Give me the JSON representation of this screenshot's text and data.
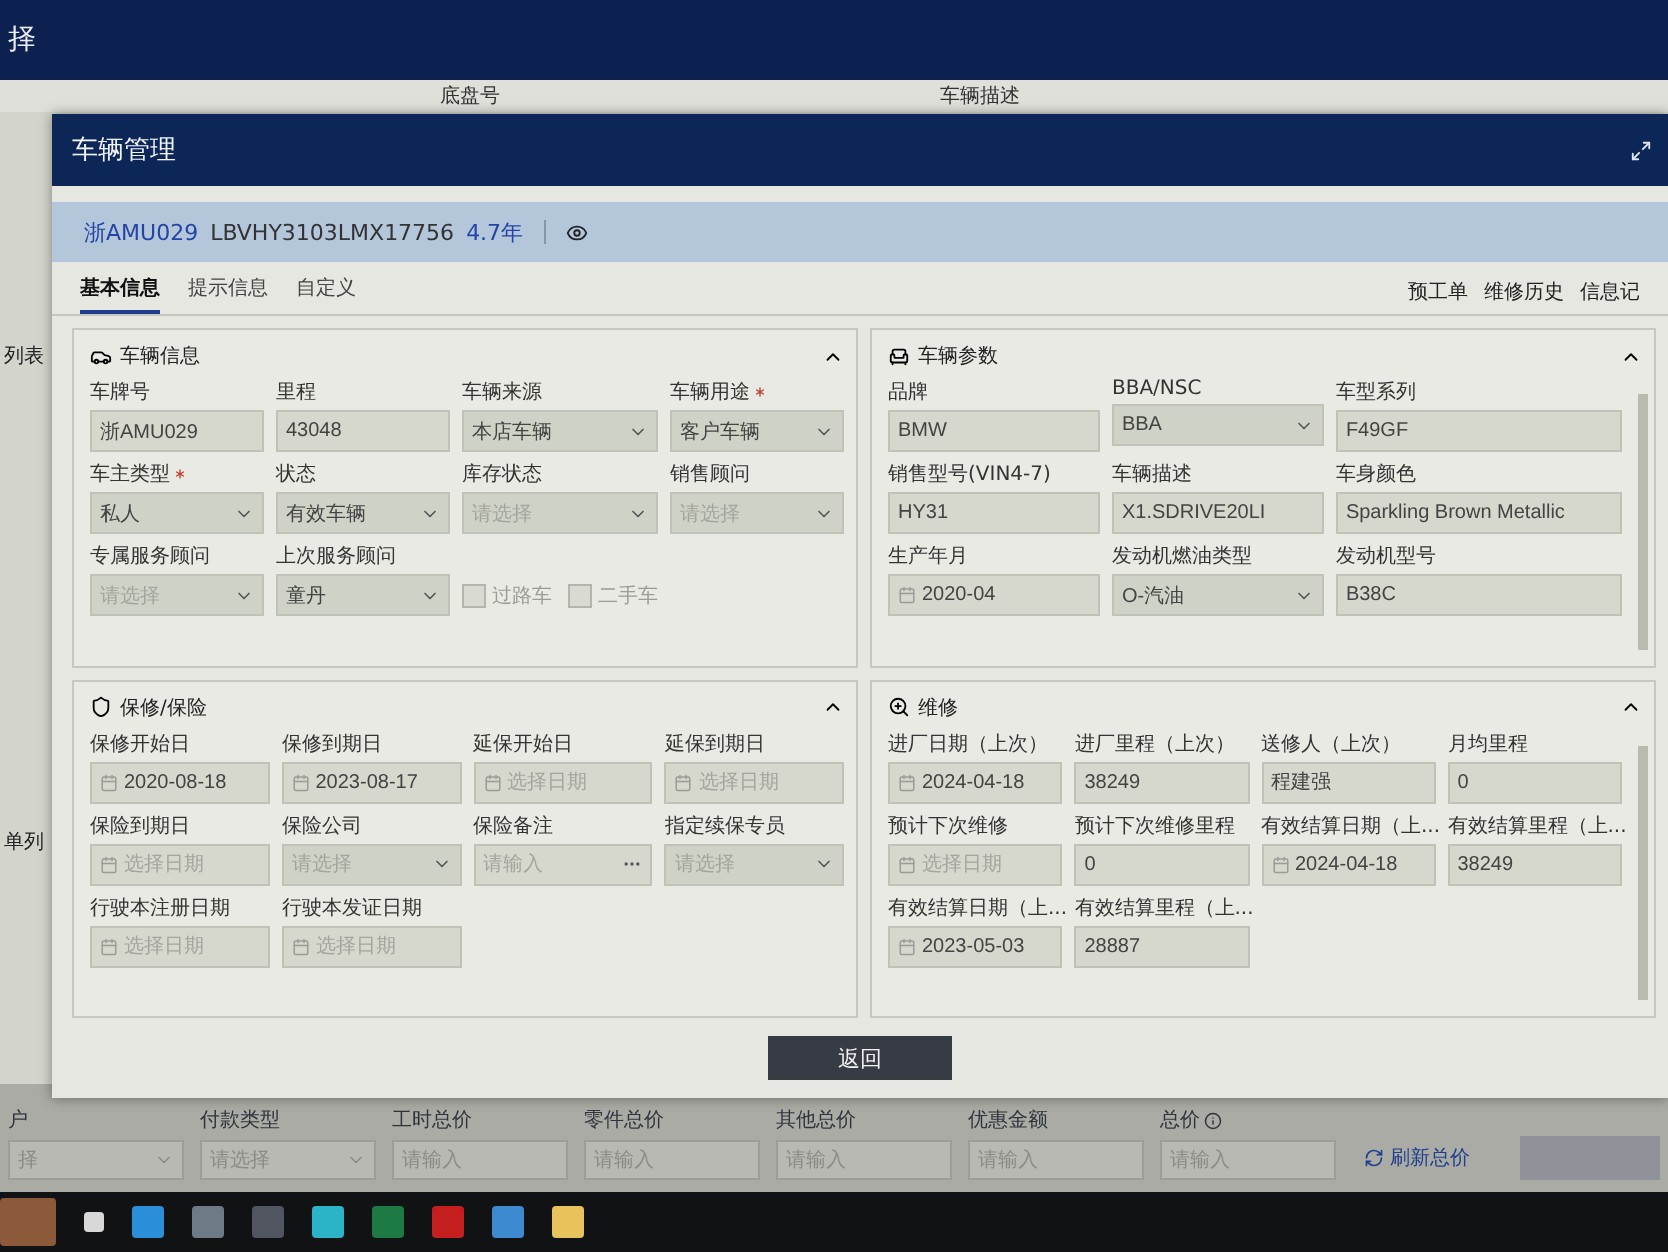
{
  "background": {
    "title": "择",
    "columns": [
      "底盘号",
      "车辆描述"
    ],
    "side_labels": [
      "列表",
      "单列"
    ],
    "footer": {
      "fields": [
        {
          "label": "户",
          "kind": "select",
          "placeholder": "择"
        },
        {
          "label": "付款类型",
          "kind": "select",
          "placeholder": "请选择"
        },
        {
          "label": "工时总价",
          "kind": "text",
          "placeholder": "请输入"
        },
        {
          "label": "零件总价",
          "kind": "text",
          "placeholder": "请输入"
        },
        {
          "label": "其他总价",
          "kind": "text",
          "placeholder": "请输入"
        },
        {
          "label": "优惠金额",
          "kind": "text",
          "placeholder": "请输入"
        },
        {
          "label": "总价",
          "kind": "text",
          "placeholder": "请输入",
          "info": true
        }
      ],
      "refresh": "刷新总价"
    }
  },
  "dialog": {
    "title": "车辆管理",
    "vehicle": {
      "plate": "浙AMU029",
      "vin": "LBVHY3103LMX17756",
      "age": "4.7年"
    },
    "tabs": [
      {
        "label": "基本信息",
        "selected": true
      },
      {
        "label": "提示信息",
        "selected": false
      },
      {
        "label": "自定义",
        "selected": false
      }
    ],
    "links": [
      "预工单",
      "维修历史",
      "信息记"
    ],
    "panels": [
      {
        "title": "车辆信息",
        "expanded": true,
        "fields": [
          {
            "label": "车牌号",
            "kind": "text",
            "value": "浙AMU029"
          },
          {
            "label": "里程",
            "kind": "text",
            "value": "43048"
          },
          {
            "label": "车辆来源",
            "kind": "select",
            "value": "本店车辆"
          },
          {
            "label": "车辆用途",
            "kind": "select",
            "value": "客户车辆",
            "required": true
          },
          {
            "label": "车主类型",
            "kind": "select",
            "value": "私人",
            "required": true
          },
          {
            "label": "状态",
            "kind": "select",
            "value": "有效车辆"
          },
          {
            "label": "库存状态",
            "kind": "select",
            "placeholder": "请选择"
          },
          {
            "label": "销售顾问",
            "kind": "select",
            "placeholder": "请选择"
          },
          {
            "label": "专属服务顾问",
            "kind": "select",
            "placeholder": "请选择"
          },
          {
            "label": "上次服务顾问",
            "kind": "select",
            "value": "童丹"
          },
          {
            "kind": "checkboxes",
            "items": [
              {
                "label": "过路车",
                "checked": false
              },
              {
                "label": "二手车",
                "checked": false
              }
            ]
          }
        ]
      },
      {
        "title": "车辆参数",
        "expanded": true,
        "fields": [
          {
            "label": "品牌",
            "kind": "text",
            "value": "BMW"
          },
          {
            "label": "BBA/NSC",
            "kind": "select",
            "value": "BBA"
          },
          {
            "label": "车型系列",
            "kind": "text",
            "value": "F49GF"
          },
          {
            "label": "销售型号(VIN4-7)",
            "kind": "text",
            "value": "HY31"
          },
          {
            "label": "车辆描述",
            "kind": "text",
            "value": "X1.SDRIVE20LI"
          },
          {
            "label": "车身颜色",
            "kind": "text",
            "value": "Sparkling Brown Metallic"
          },
          {
            "label": "生产年月",
            "kind": "date",
            "value": "2020-04"
          },
          {
            "label": "发动机燃油类型",
            "kind": "select",
            "value": "O-汽油"
          },
          {
            "label": "发动机型号",
            "kind": "text",
            "value": "B38C"
          }
        ]
      },
      {
        "title": "保修/保险",
        "expanded": true,
        "fields": [
          {
            "label": "保修开始日",
            "kind": "date",
            "value": "2020-08-18"
          },
          {
            "label": "保修到期日",
            "kind": "date",
            "value": "2023-08-17"
          },
          {
            "label": "延保开始日",
            "kind": "date",
            "placeholder": "选择日期"
          },
          {
            "label": "延保到期日",
            "kind": "date",
            "placeholder": "选择日期"
          },
          {
            "label": "保险到期日",
            "kind": "date",
            "placeholder": "选择日期"
          },
          {
            "label": "保险公司",
            "kind": "select",
            "placeholder": "请选择"
          },
          {
            "label": "保险备注",
            "kind": "more",
            "placeholder": "请输入"
          },
          {
            "label": "指定续保专员",
            "kind": "select",
            "placeholder": "请选择"
          },
          {
            "label": "行驶本注册日期",
            "kind": "date",
            "placeholder": "选择日期"
          },
          {
            "label": "行驶本发证日期",
            "kind": "date",
            "placeholder": "选择日期"
          }
        ]
      },
      {
        "title": "维修",
        "expanded": true,
        "fields": [
          {
            "label": "进厂日期（上次）",
            "kind": "date",
            "value": "2024-04-18"
          },
          {
            "label": "进厂里程（上次）",
            "kind": "text",
            "value": "38249"
          },
          {
            "label": "送修人（上次）",
            "kind": "text",
            "value": "程建强"
          },
          {
            "label": "月均里程",
            "kind": "text",
            "value": "0"
          },
          {
            "label": "预计下次维修",
            "kind": "date",
            "placeholder": "选择日期"
          },
          {
            "label": "预计下次维修里程",
            "kind": "text",
            "value": "0"
          },
          {
            "label": "有效结算日期（上...",
            "kind": "date",
            "value": "2024-04-18"
          },
          {
            "label": "有效结算里程（上...",
            "kind": "text",
            "value": "38249"
          },
          {
            "label": "有效结算日期（上...",
            "kind": "date",
            "value": "2023-05-03"
          },
          {
            "label": "有效结算里程（上...",
            "kind": "text",
            "value": "28887"
          }
        ]
      }
    ],
    "back_button": "返回"
  }
}
